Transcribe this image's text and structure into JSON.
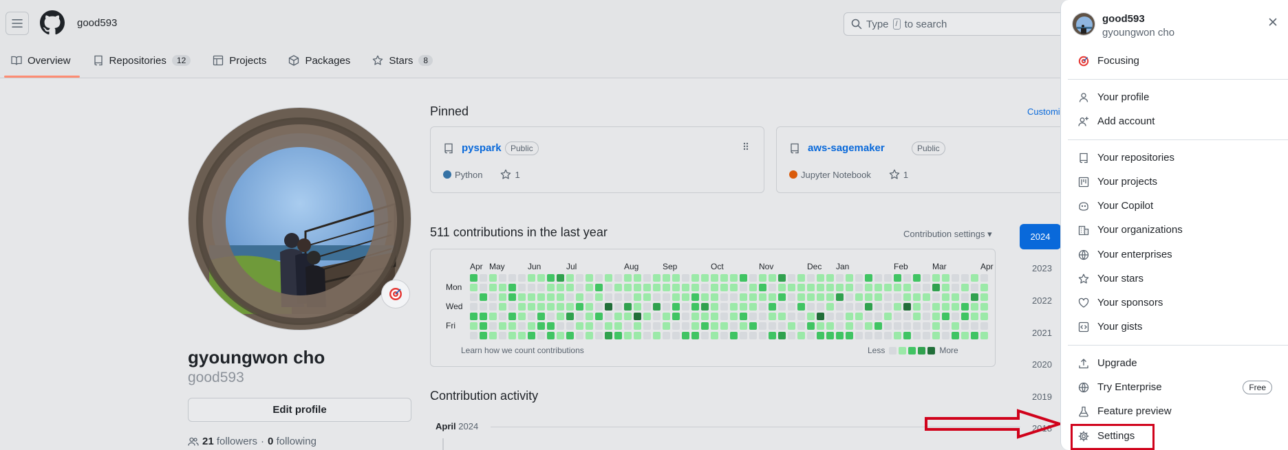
{
  "header": {
    "username": "good593",
    "search_prefix": "Type",
    "search_key": "/",
    "search_suffix": "to search"
  },
  "tabs": [
    {
      "label": "Overview",
      "count": null,
      "icon": "book-icon"
    },
    {
      "label": "Repositories",
      "count": "12",
      "icon": "repo-icon"
    },
    {
      "label": "Projects",
      "count": null,
      "icon": "table-icon"
    },
    {
      "label": "Packages",
      "count": null,
      "icon": "package-icon"
    },
    {
      "label": "Stars",
      "count": "8",
      "icon": "star-icon"
    }
  ],
  "profile": {
    "full_name": "gyoungwon cho",
    "login": "good593",
    "edit_label": "Edit profile",
    "followers": "21",
    "followers_label": "followers",
    "following": "0",
    "following_label": "following"
  },
  "pinned": {
    "title": "Pinned",
    "customize": "Customi",
    "cards": [
      {
        "name": "pyspark",
        "visibility": "Public",
        "language": "Python",
        "lang_color": "#3572A5",
        "stars": "1"
      },
      {
        "name": "aws-sagemaker",
        "visibility": "Public",
        "language": "Jupyter Notebook",
        "lang_color": "#DA5B0B",
        "stars": "1"
      }
    ]
  },
  "contributions": {
    "title": "511 contributions in the last year",
    "settings": "Contribution settings",
    "months": [
      "Apr",
      "May",
      "Jun",
      "Jul",
      "Aug",
      "Sep",
      "Oct",
      "Nov",
      "Dec",
      "Jan",
      "Feb",
      "Mar",
      "Apr"
    ],
    "days": [
      "Mon",
      "Wed",
      "Fri"
    ],
    "learn": "Learn how we count contributions",
    "less": "Less",
    "more": "More",
    "levels": [
      "#ebedf0",
      "#9be9a8",
      "#40c463",
      "#30a14e",
      "#216e39"
    ],
    "years": [
      "2024",
      "2023",
      "2022",
      "2021",
      "2020",
      "2019",
      "2018"
    ]
  },
  "activity": {
    "title": "Contribution activity",
    "month": "April",
    "year": "2024"
  },
  "menu": {
    "username": "good593",
    "full_name": "gyoungwon cho",
    "status": "Focusing",
    "items_group1": [
      {
        "label": "Your profile",
        "icon": "person-icon"
      },
      {
        "label": "Add account",
        "icon": "person-add-icon"
      }
    ],
    "items_group2": [
      {
        "label": "Your repositories",
        "icon": "repo-icon"
      },
      {
        "label": "Your projects",
        "icon": "project-icon"
      },
      {
        "label": "Your Copilot",
        "icon": "copilot-icon"
      },
      {
        "label": "Your organizations",
        "icon": "organization-icon"
      },
      {
        "label": "Your enterprises",
        "icon": "globe-icon"
      },
      {
        "label": "Your stars",
        "icon": "star-icon"
      },
      {
        "label": "Your sponsors",
        "icon": "heart-icon"
      },
      {
        "label": "Your gists",
        "icon": "code-square-icon"
      }
    ],
    "items_group3": [
      {
        "label": "Upgrade",
        "icon": "upload-icon"
      },
      {
        "label": "Try Enterprise",
        "icon": "globe-icon",
        "badge": "Free"
      },
      {
        "label": "Feature preview",
        "icon": "beaker-icon"
      },
      {
        "label": "Settings",
        "icon": "gear-icon"
      }
    ]
  }
}
